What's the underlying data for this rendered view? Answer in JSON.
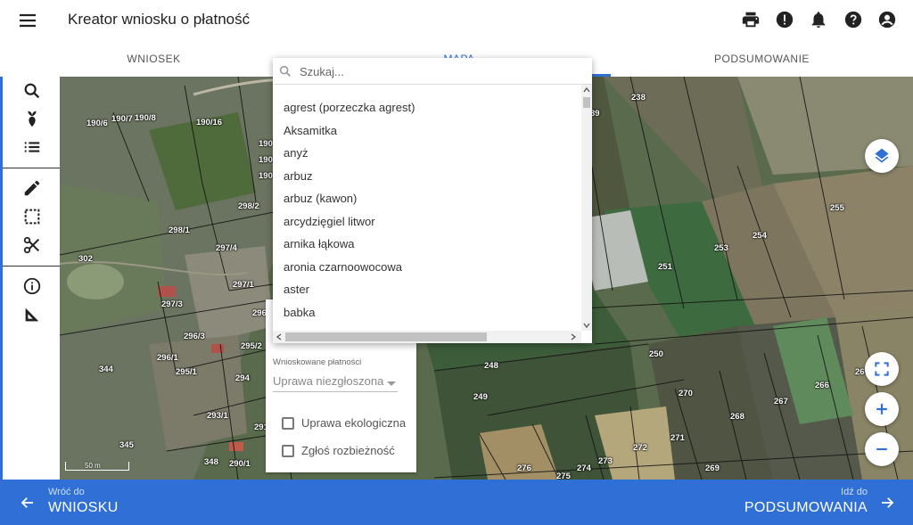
{
  "header": {
    "title": "Kreator wniosku o płatność",
    "icons": [
      "menu-icon",
      "print-icon",
      "alert-icon",
      "bell-icon",
      "help-icon",
      "account-icon"
    ]
  },
  "tabs": [
    {
      "label": "WNIOSEK",
      "active": false
    },
    {
      "label": "MAPA",
      "active": true
    },
    {
      "label": "PODSUMOWANIE",
      "active": false
    }
  ],
  "toolbar": {
    "tools": [
      "search-icon",
      "plant-icon",
      "list-icon",
      "pencil-icon",
      "select-area-icon",
      "scissors-icon",
      "info-icon",
      "measure-icon"
    ]
  },
  "search": {
    "placeholder": "Szukaj..."
  },
  "crop_options": [
    "agrest (porzeczka agrest)",
    "Aksamitka",
    "anyż",
    "arbuz",
    "arbuz (kawon)",
    "arcydzięgiel litwor",
    "arnika łąkowa",
    "aronia czarnoowocowa",
    "aster",
    "babka"
  ],
  "panel": {
    "payments_label": "Wnioskowane płatności",
    "payments_value": "Uprawa niezgłoszona",
    "organic_label": "Uprawa ekologiczna",
    "discrepancy_label": "Zgłoś rozbieżność"
  },
  "map": {
    "scale_label": "50 m",
    "parcels": [
      "190/6",
      "190/7",
      "190/8",
      "190/16",
      "190",
      "190",
      "190",
      "298/2",
      "298/1",
      "297/4",
      "302",
      "297/1",
      "297/3",
      "296",
      "296/3",
      "296/1",
      "295/2",
      "295/1",
      "294",
      "293/1",
      "291",
      "290/1",
      "348",
      "344",
      "345",
      "238",
      "39",
      "255",
      "254",
      "253",
      "251",
      "250",
      "248",
      "249",
      "270",
      "268",
      "267",
      "266",
      "26",
      "271",
      "272",
      "273",
      "274",
      "275",
      "276",
      "269"
    ]
  },
  "bottom": {
    "back_caption": "Wróć do",
    "back_label": "WNIOSKU",
    "next_caption": "Idź do",
    "next_label": "PODSUMOWANIA"
  },
  "colors": {
    "accent": "#2f6fd6"
  }
}
